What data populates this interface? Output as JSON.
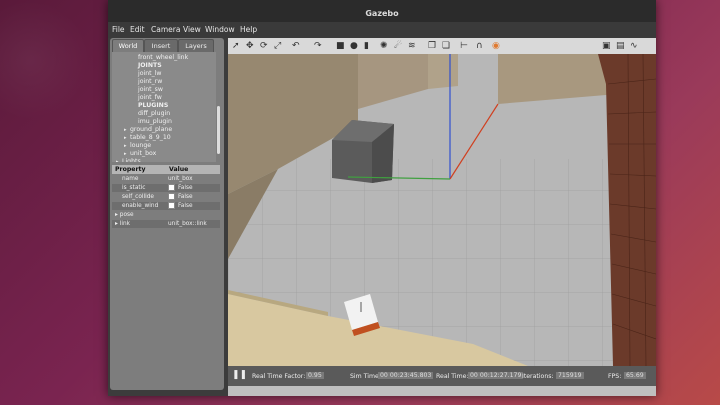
{
  "window": {
    "title": "Gazebo"
  },
  "menu": [
    "File",
    "Edit",
    "Camera",
    "View",
    "Window",
    "Help"
  ],
  "left_panel": {
    "tabs": [
      "World",
      "Insert",
      "Layers"
    ],
    "active_tab": "World",
    "tree": [
      {
        "label": "front_wheel_link",
        "indent": 3,
        "bold": false,
        "arrow": ""
      },
      {
        "label": "JOINTS",
        "indent": 3,
        "bold": true,
        "arrow": ""
      },
      {
        "label": "joint_lw",
        "indent": 3,
        "bold": false,
        "arrow": ""
      },
      {
        "label": "joint_rw",
        "indent": 3,
        "bold": false,
        "arrow": ""
      },
      {
        "label": "joint_sw",
        "indent": 3,
        "bold": false,
        "arrow": ""
      },
      {
        "label": "joint_fw",
        "indent": 3,
        "bold": false,
        "arrow": ""
      },
      {
        "label": "PLUGINS",
        "indent": 3,
        "bold": true,
        "arrow": ""
      },
      {
        "label": "diff_plugin",
        "indent": 3,
        "bold": false,
        "arrow": ""
      },
      {
        "label": "imu_plugin",
        "indent": 3,
        "bold": false,
        "arrow": ""
      },
      {
        "label": "ground_plane",
        "indent": 2,
        "bold": false,
        "arrow": "▸"
      },
      {
        "label": "table_8_9_10",
        "indent": 2,
        "bold": false,
        "arrow": "▸"
      },
      {
        "label": "lounge",
        "indent": 2,
        "bold": false,
        "arrow": "▸"
      },
      {
        "label": "unit_box",
        "indent": 2,
        "bold": false,
        "arrow": "▸"
      },
      {
        "label": "Lights",
        "indent": 1,
        "bold": false,
        "arrow": "▸"
      }
    ],
    "properties": {
      "header_property": "Property",
      "header_value": "Value",
      "rows": [
        {
          "name": "name",
          "value": "unit_box",
          "checkbox": false,
          "expand": false
        },
        {
          "name": "is_static",
          "value": "False",
          "checkbox": true,
          "expand": false
        },
        {
          "name": "self_collide",
          "value": "False",
          "checkbox": true,
          "expand": false
        },
        {
          "name": "enable_wind",
          "value": "False",
          "checkbox": true,
          "expand": false
        },
        {
          "name": "pose",
          "value": "",
          "checkbox": false,
          "expand": true
        },
        {
          "name": "link",
          "value": "unit_box::link",
          "checkbox": false,
          "expand": true
        }
      ]
    }
  },
  "toolbar_icons": [
    "select-arrow-icon",
    "translate-icon",
    "rotate-icon",
    "scale-icon",
    "undo-icon",
    "redo-icon",
    "box-icon",
    "sphere-icon",
    "cylinder-icon",
    "point-light-icon",
    "spot-light-icon",
    "directional-light-icon",
    "copy-icon",
    "paste-icon",
    "align-icon",
    "snap-icon",
    "change-view-icon",
    "screenshot-icon",
    "log-icon",
    "plot-icon"
  ],
  "status": {
    "pause_icon": "pause-icon",
    "real_time_factor_label": "Real Time Factor:",
    "real_time_factor": "0.95",
    "sim_time_label": "Sim Time:",
    "sim_time": "00 00:23:45.803",
    "real_time_label": "Real Time:",
    "real_time": "00 00:12:27.179",
    "iterations_label": "Iterations:",
    "iterations": "715919",
    "fps_label": "FPS:",
    "fps": "65.69"
  },
  "colors": {
    "accent": "#e07a30",
    "x_axis": "#d04020",
    "y_axis": "#40a040",
    "z_axis": "#3050d0"
  }
}
